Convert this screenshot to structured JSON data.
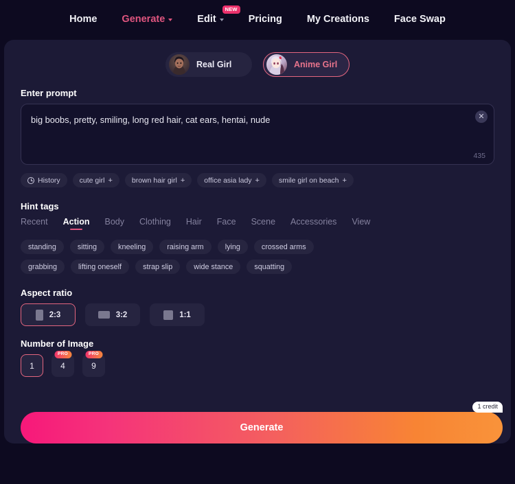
{
  "nav": {
    "items": [
      {
        "label": "Home",
        "active": false,
        "caret": false,
        "badge": null
      },
      {
        "label": "Generate",
        "active": true,
        "caret": true,
        "badge": null
      },
      {
        "label": "Edit",
        "active": false,
        "caret": true,
        "badge": "NEW"
      },
      {
        "label": "Pricing",
        "active": false,
        "caret": false,
        "badge": null
      },
      {
        "label": "My Creations",
        "active": false,
        "caret": false,
        "badge": null
      },
      {
        "label": "Face Swap",
        "active": false,
        "caret": false,
        "badge": null
      }
    ]
  },
  "style_tabs": [
    {
      "label": "Real Girl",
      "selected": false,
      "thumb": "real-girl-photo"
    },
    {
      "label": "Anime Girl",
      "selected": true,
      "thumb": "anime-girl-art"
    }
  ],
  "prompt": {
    "heading": "Enter prompt",
    "value": "big boobs, pretty, smiling, long red hair, cat ears, hentai, nude",
    "placeholder": "Enter prompt",
    "char_count": "435",
    "clear_icon": "close-icon"
  },
  "chips": {
    "history_label": "History",
    "history_icon": "clock-icon",
    "items": [
      {
        "label": "cute girl",
        "plus": "+"
      },
      {
        "label": "brown hair girl",
        "plus": "+"
      },
      {
        "label": "office asia lady",
        "plus": "+"
      },
      {
        "label": "smile girl on beach",
        "plus": "+"
      }
    ]
  },
  "hint_tags": {
    "heading": "Hint tags",
    "tabs": [
      {
        "label": "Recent",
        "active": false
      },
      {
        "label": "Action",
        "active": true
      },
      {
        "label": "Body",
        "active": false
      },
      {
        "label": "Clothing",
        "active": false
      },
      {
        "label": "Hair",
        "active": false
      },
      {
        "label": "Face",
        "active": false
      },
      {
        "label": "Scene",
        "active": false
      },
      {
        "label": "Accessories",
        "active": false
      },
      {
        "label": "View",
        "active": false
      }
    ],
    "tags": [
      "standing",
      "sitting",
      "kneeling",
      "raising arm",
      "lying",
      "crossed arms",
      "grabbing",
      "lifting oneself",
      "strap slip",
      "wide stance",
      "squatting"
    ]
  },
  "aspect_ratio": {
    "heading": "Aspect ratio",
    "options": [
      {
        "label": "2:3",
        "selected": true,
        "shape": "portrait-icon"
      },
      {
        "label": "3:2",
        "selected": false,
        "shape": "landscape-icon"
      },
      {
        "label": "1:1",
        "selected": false,
        "shape": "square-icon"
      }
    ]
  },
  "number_of_image": {
    "heading": "Number of Image",
    "options": [
      {
        "label": "1",
        "selected": true,
        "badge": null
      },
      {
        "label": "4",
        "selected": false,
        "badge": "PRO"
      },
      {
        "label": "9",
        "selected": false,
        "badge": "PRO"
      }
    ]
  },
  "generate": {
    "label": "Generate",
    "credit_badge": "1 credit"
  },
  "colors": {
    "page_bg": "#0d0a20",
    "panel_bg": "#1c1a36",
    "input_bg": "#13112b",
    "chip_bg": "#272540",
    "accent_pink": "#e0557f",
    "accent_border": "#e4667f",
    "gradient_start": "#f7187a",
    "gradient_end": "#f9933a"
  }
}
